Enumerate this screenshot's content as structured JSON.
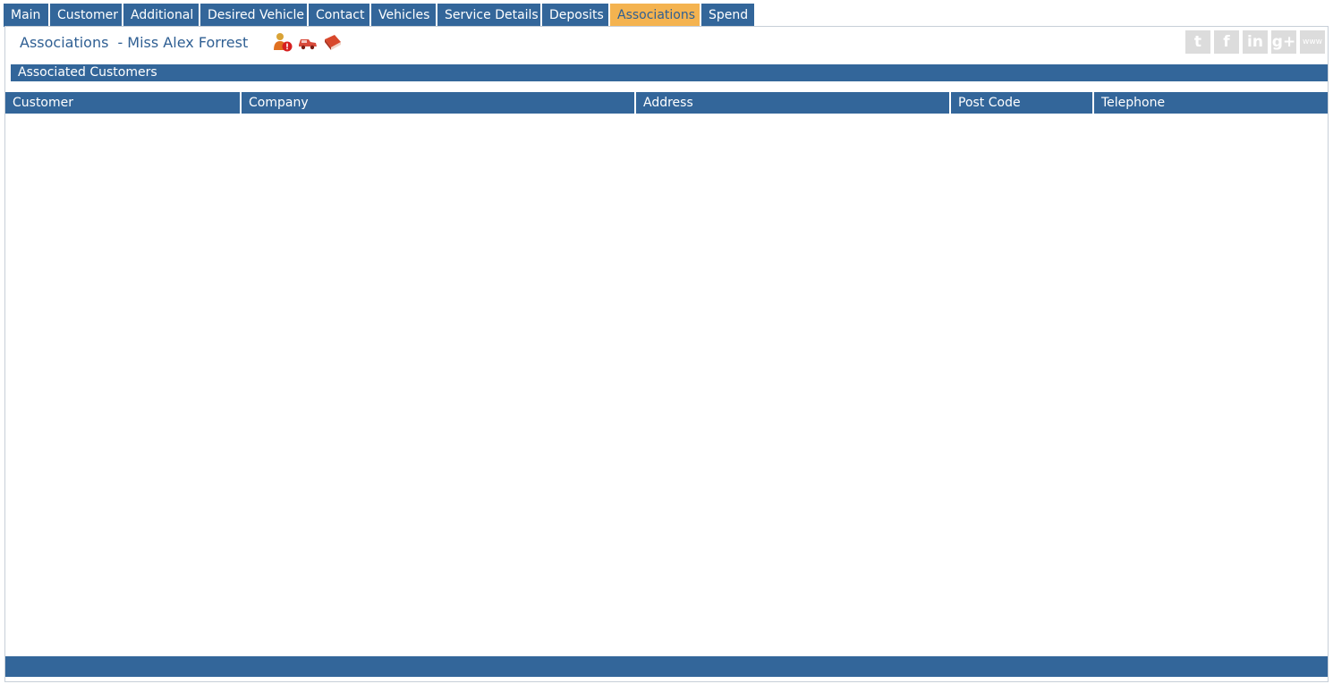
{
  "tabs": [
    {
      "label": "Main",
      "active": false
    },
    {
      "label": "Customer",
      "active": false
    },
    {
      "label": "Additional",
      "active": false
    },
    {
      "label": "Desired Vehicle",
      "active": false
    },
    {
      "label": "Contact",
      "active": false
    },
    {
      "label": "Vehicles",
      "active": false
    },
    {
      "label": "Service Details",
      "active": false
    },
    {
      "label": "Deposits",
      "active": false
    },
    {
      "label": "Associations",
      "active": true
    },
    {
      "label": "Spend",
      "active": false
    }
  ],
  "header": {
    "title": "Associations",
    "customer_name": "- Miss Alex Forrest",
    "record_icons": [
      "customer-alert-icon",
      "vehicle-icon",
      "book-icon"
    ]
  },
  "social": {
    "twitter": "t",
    "facebook": "f",
    "linkedin": "in",
    "googleplus": "g+",
    "website": "www"
  },
  "section": {
    "title": "Associated Customers"
  },
  "table": {
    "columns": [
      "Customer",
      "Company",
      "Address",
      "Post Code",
      "Telephone"
    ],
    "rows": []
  },
  "colors": {
    "primary": "#33669a",
    "active_tab": "#f4b350",
    "active_tab_text": "#2e5f93",
    "title_text": "#2f5f93",
    "social_icon": "#dcdcdc"
  }
}
